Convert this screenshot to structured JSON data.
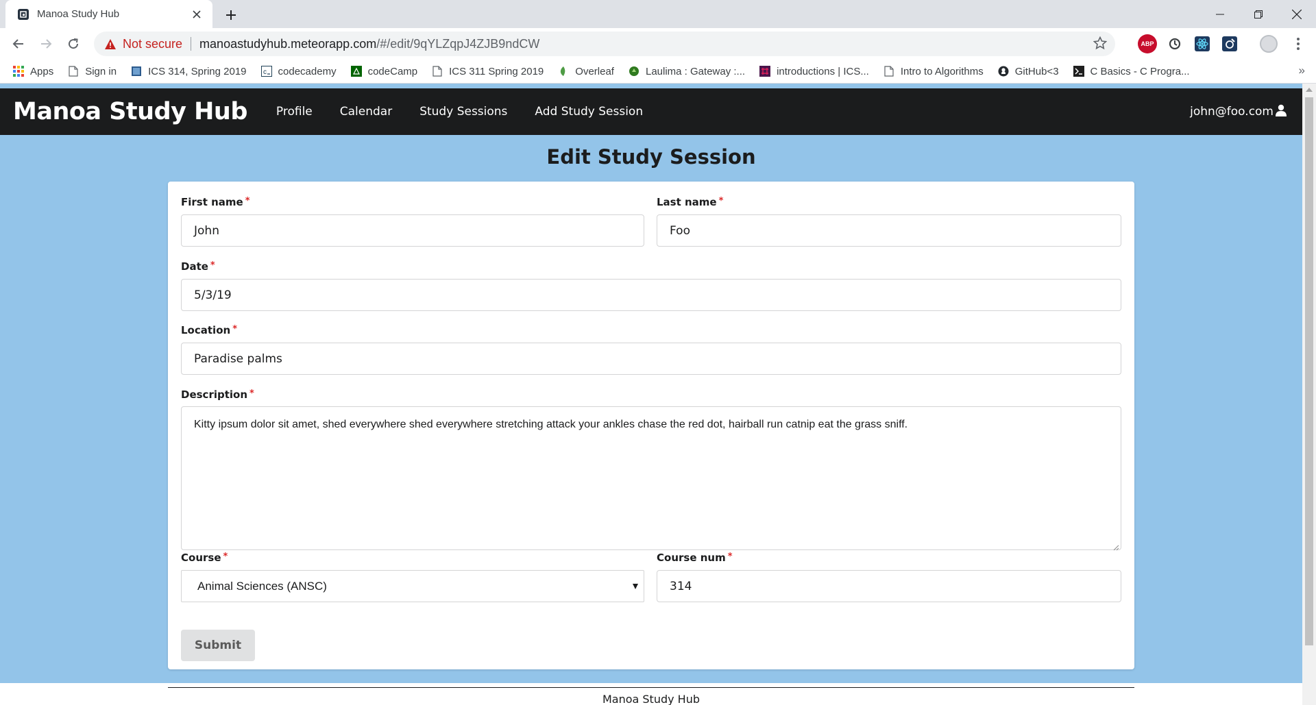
{
  "browser": {
    "tab_title": "Manoa Study Hub",
    "security_label": "Not secure",
    "url_host": "manoastudyhub.meteorapp.com",
    "url_path": "/#/edit/9qYLZqpJ4ZJB9ndCW",
    "bookmarks": [
      {
        "label": "Apps",
        "icon": "apps-grid-icon"
      },
      {
        "label": "Sign in",
        "icon": "page-icon"
      },
      {
        "label": "ICS 314, Spring 2019",
        "icon": "site-icon"
      },
      {
        "label": "codecademy",
        "icon": "codecademy-icon"
      },
      {
        "label": "codeCamp",
        "icon": "codecamp-icon"
      },
      {
        "label": "ICS 311 Spring 2019",
        "icon": "page-icon"
      },
      {
        "label": "Overleaf",
        "icon": "overleaf-icon"
      },
      {
        "label": "Laulima : Gateway :...",
        "icon": "laulima-icon"
      },
      {
        "label": "introductions | ICS...",
        "icon": "slack-icon"
      },
      {
        "label": "Intro to Algorithms",
        "icon": "page-icon"
      },
      {
        "label": "GitHub<3",
        "icon": "github-icon"
      },
      {
        "label": "C Basics - C Progra...",
        "icon": "terminal-icon"
      }
    ],
    "bookmarks_more": "»"
  },
  "navbar": {
    "brand": "Manoa Study Hub",
    "items": [
      "Profile",
      "Calendar",
      "Study Sessions",
      "Add Study Session"
    ],
    "user": "john@foo.com"
  },
  "page": {
    "title": "Edit Study Session"
  },
  "form": {
    "first_name": {
      "label": "First name",
      "value": "John"
    },
    "last_name": {
      "label": "Last name",
      "value": "Foo"
    },
    "date": {
      "label": "Date",
      "value": "5/3/19"
    },
    "location": {
      "label": "Location",
      "value": "Paradise palms"
    },
    "description": {
      "label": "Description",
      "value": "Kitty ipsum dolor sit amet, shed everywhere shed everywhere stretching attack your ankles chase the red dot, hairball run catnip eat the grass sniff."
    },
    "course": {
      "label": "Course",
      "value": "Animal Sciences (ANSC)"
    },
    "course_num": {
      "label": "Course num",
      "value": "314"
    },
    "required_marker": "*",
    "submit_label": "Submit"
  },
  "footer": {
    "text": "Manoa Study Hub"
  },
  "colors": {
    "page_bg": "#93c4e9",
    "navbar_bg": "#1b1c1d",
    "required": "#db2828",
    "not_secure": "#c5221f"
  }
}
